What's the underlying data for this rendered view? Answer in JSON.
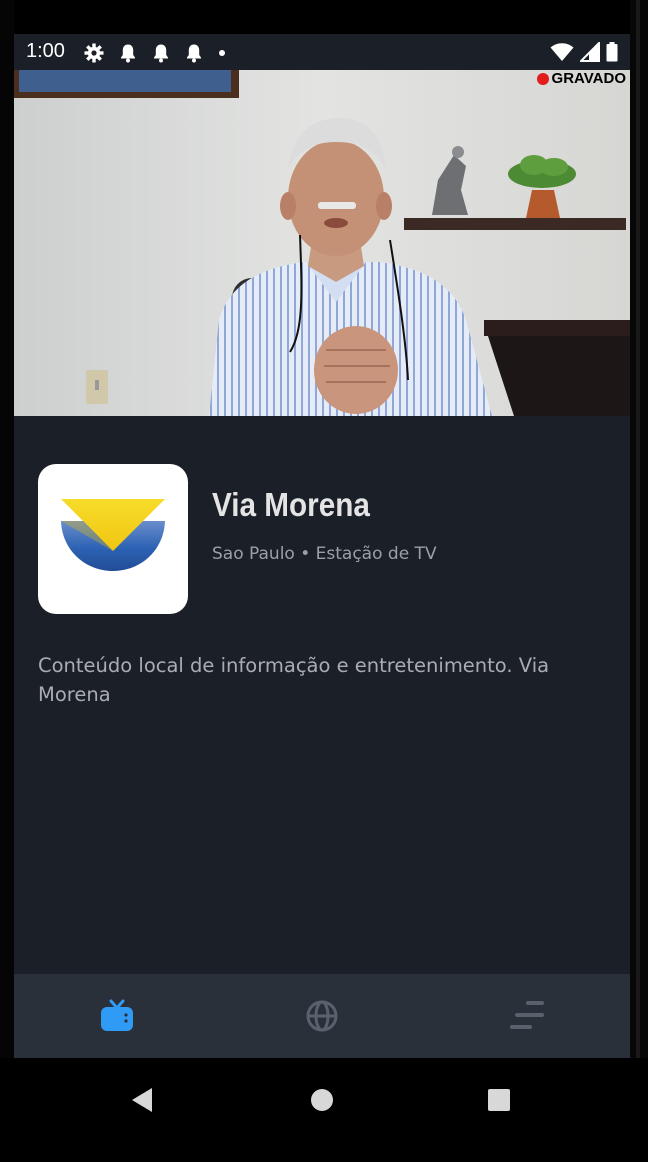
{
  "status_bar": {
    "time": "1:00",
    "left_icons": [
      "settings-icon",
      "notification-bell-icon",
      "notification-bell-icon",
      "notification-bell-icon",
      "dot-icon"
    ],
    "right_icons": [
      "wifi-icon",
      "cell-signal-icon",
      "battery-icon"
    ]
  },
  "video": {
    "recording_label": "GRAVADO",
    "recording_color": "#e21b1b"
  },
  "channel": {
    "name": "Via Morena",
    "meta": "Sao Paulo • Estação de TV",
    "description": "Conteúdo local de informação e entretenimento. Via Morena"
  },
  "bottom_nav": {
    "items": [
      {
        "icon": "tv-icon",
        "active": true
      },
      {
        "icon": "globe-icon",
        "active": false
      },
      {
        "icon": "sort-lines-icon",
        "active": false
      }
    ],
    "active_color": "#2f9bf5",
    "inactive_color": "#59616d"
  },
  "system_nav": {
    "buttons": [
      "back-icon",
      "home-icon",
      "recents-icon"
    ]
  },
  "colors": {
    "background": "#1b1f27",
    "nav_background": "#2a303a",
    "logo_yellow": "#f5d51c",
    "logo_blue": "#2c62b3"
  }
}
